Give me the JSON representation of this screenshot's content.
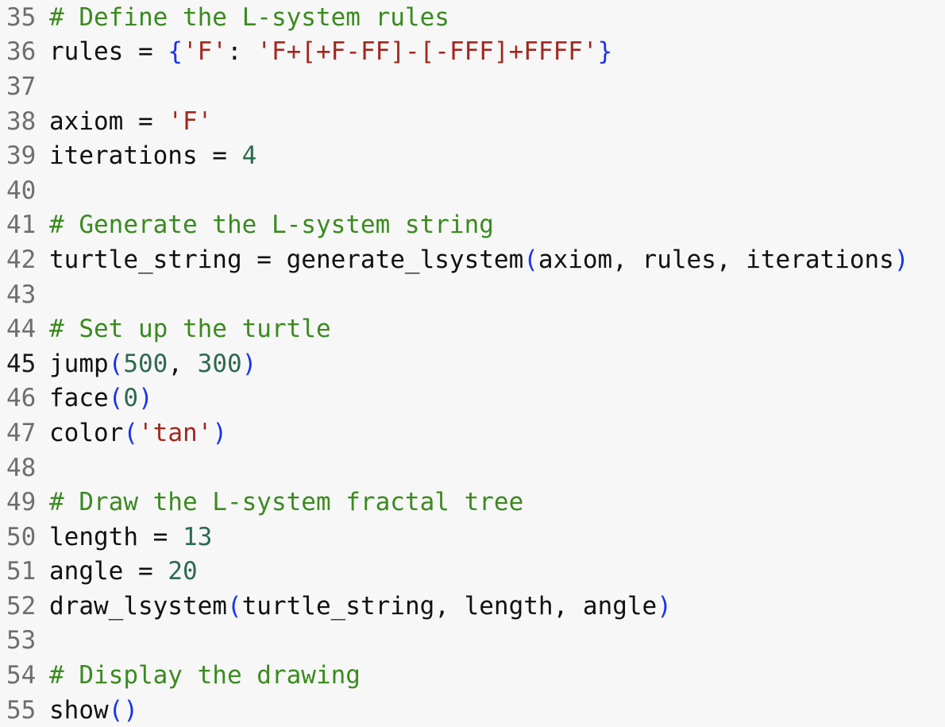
{
  "editor": {
    "lines": [
      {
        "number": "35",
        "tokens": [
          {
            "t": "cm",
            "v": "# Define the L-system rules"
          }
        ]
      },
      {
        "number": "36",
        "tokens": [
          {
            "t": "tx",
            "v": "rules = "
          },
          {
            "t": "br",
            "v": "{"
          },
          {
            "t": "st",
            "v": "'F'"
          },
          {
            "t": "tx",
            "v": ": "
          },
          {
            "t": "st",
            "v": "'F+[+F-FF]-[-FFF]+FFFF'"
          },
          {
            "t": "br",
            "v": "}"
          }
        ]
      },
      {
        "number": "37",
        "tokens": []
      },
      {
        "number": "38",
        "tokens": [
          {
            "t": "tx",
            "v": "axiom = "
          },
          {
            "t": "st",
            "v": "'F'"
          }
        ]
      },
      {
        "number": "39",
        "tokens": [
          {
            "t": "tx",
            "v": "iterations = "
          },
          {
            "t": "nu",
            "v": "4"
          }
        ]
      },
      {
        "number": "40",
        "tokens": []
      },
      {
        "number": "41",
        "tokens": [
          {
            "t": "cm",
            "v": "# Generate the L-system string"
          }
        ]
      },
      {
        "number": "42",
        "tokens": [
          {
            "t": "tx",
            "v": "turtle_string = generate_lsystem"
          },
          {
            "t": "br",
            "v": "("
          },
          {
            "t": "tx",
            "v": "axiom, rules, iterations"
          },
          {
            "t": "br",
            "v": ")"
          }
        ]
      },
      {
        "number": "43",
        "tokens": []
      },
      {
        "number": "44",
        "tokens": [
          {
            "t": "cm",
            "v": "# Set up the turtle"
          }
        ]
      },
      {
        "number": "45",
        "active": true,
        "tokens": [
          {
            "t": "tx",
            "v": "jump"
          },
          {
            "t": "br",
            "v": "("
          },
          {
            "t": "nu",
            "v": "500"
          },
          {
            "t": "tx",
            "v": ", "
          },
          {
            "t": "nu",
            "v": "300"
          },
          {
            "t": "br",
            "v": ")"
          }
        ]
      },
      {
        "number": "46",
        "tokens": [
          {
            "t": "tx",
            "v": "face"
          },
          {
            "t": "br",
            "v": "("
          },
          {
            "t": "nu",
            "v": "0"
          },
          {
            "t": "br",
            "v": ")"
          }
        ]
      },
      {
        "number": "47",
        "tokens": [
          {
            "t": "tx",
            "v": "color"
          },
          {
            "t": "br",
            "v": "("
          },
          {
            "t": "st",
            "v": "'tan'"
          },
          {
            "t": "br",
            "v": ")"
          }
        ]
      },
      {
        "number": "48",
        "tokens": []
      },
      {
        "number": "49",
        "tokens": [
          {
            "t": "cm",
            "v": "# Draw the L-system fractal tree"
          }
        ]
      },
      {
        "number": "50",
        "tokens": [
          {
            "t": "tx",
            "v": "length = "
          },
          {
            "t": "nu",
            "v": "13"
          }
        ]
      },
      {
        "number": "51",
        "tokens": [
          {
            "t": "tx",
            "v": "angle = "
          },
          {
            "t": "nu",
            "v": "20"
          }
        ]
      },
      {
        "number": "52",
        "tokens": [
          {
            "t": "tx",
            "v": "draw_lsystem"
          },
          {
            "t": "br",
            "v": "("
          },
          {
            "t": "tx",
            "v": "turtle_string, length, angle"
          },
          {
            "t": "br",
            "v": ")"
          }
        ]
      },
      {
        "number": "53",
        "tokens": []
      },
      {
        "number": "54",
        "tokens": [
          {
            "t": "cm",
            "v": "# Display the drawing"
          }
        ]
      },
      {
        "number": "55",
        "tokens": [
          {
            "t": "tx",
            "v": "show"
          },
          {
            "t": "br",
            "v": "()"
          }
        ]
      }
    ]
  }
}
